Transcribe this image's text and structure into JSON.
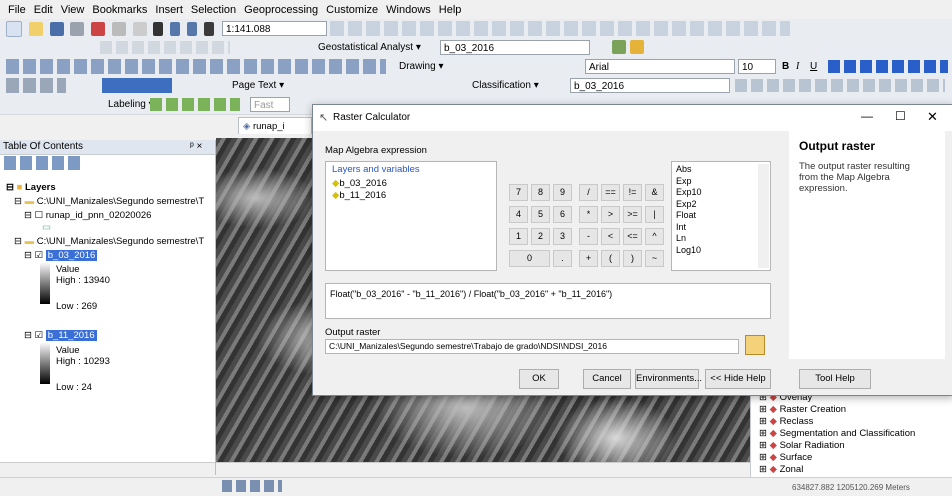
{
  "menu": [
    "File",
    "Edit",
    "View",
    "Bookmarks",
    "Insert",
    "Selection",
    "Geoprocessing",
    "Customize",
    "Windows",
    "Help"
  ],
  "toolbar": {
    "scale": "1:141.088",
    "geostat_label": "Geostatistical Analyst ▾",
    "layer_combo1": "b_03_2016",
    "drawing_label": "Drawing ▾",
    "font": "Arial",
    "font_size": "10",
    "bold": "B",
    "italic": "I",
    "underline": "U",
    "page_text": "Page Text ▾",
    "classification_label": "Classification ▾",
    "layer_combo2": "b_03_2016",
    "labeling_label": "Labeling ▾",
    "fast_label": "Fast"
  },
  "map_tab": "runap_i",
  "toc": {
    "title": "Table Of Contents",
    "layers_label": "Layers",
    "group1_path": "C:\\UNI_Manizales\\Segundo semestre\\T",
    "runap_layer": "runap_id_pnn_02020026",
    "group2_path": "C:\\UNI_Manizales\\Segundo semestre\\T",
    "raster1": {
      "name": "b_03_2016",
      "value_label": "Value",
      "high": "High : 13940",
      "low": "Low : 269"
    },
    "raster2": {
      "name": "b_11_2016",
      "value_label": "Value",
      "high": "High : 10293",
      "low": "Low : 24"
    }
  },
  "dialog": {
    "title": "Raster Calculator",
    "map_algebra_label": "Map Algebra expression",
    "layers_variables_label": "Layers and variables",
    "layers": [
      "b_03_2016",
      "b_11_2016"
    ],
    "calc_rows": [
      [
        "7",
        "8",
        "9",
        "/",
        "==",
        "!=",
        "&"
      ],
      [
        "4",
        "5",
        "6",
        "*",
        ">",
        ">=",
        "|"
      ],
      [
        "1",
        "2",
        "3",
        "-",
        "<",
        "<=",
        "^"
      ],
      [
        "0",
        ".",
        "+",
        "(",
        ")",
        "~"
      ]
    ],
    "functions": [
      "Abs",
      "Exp",
      "Exp10",
      "Exp2",
      "Float",
      "Int",
      "Ln",
      "Log10"
    ],
    "expression": "Float(\"b_03_2016\" - \"b_11_2016\") / Float(\"b_03_2016\" + \"b_11_2016\")",
    "output_label": "Output raster",
    "output_path": "C:\\UNI_Manizales\\Segundo semestre\\Trabajo de grado\\NDSI\\NDSI_2016",
    "buttons": {
      "ok": "OK",
      "cancel": "Cancel",
      "environments": "Environments...",
      "hide_help": "<< Hide Help",
      "tool_help": "Tool Help"
    },
    "help_title": "Output raster",
    "help_text": "The output raster resulting from the Map Algebra expression."
  },
  "toolbox": [
    "Overlay",
    "Raster Creation",
    "Reclass",
    "Segmentation and Classification",
    "Solar Radiation",
    "Surface",
    "Zonal"
  ],
  "status": "634827.882  1205120.269 Meters"
}
